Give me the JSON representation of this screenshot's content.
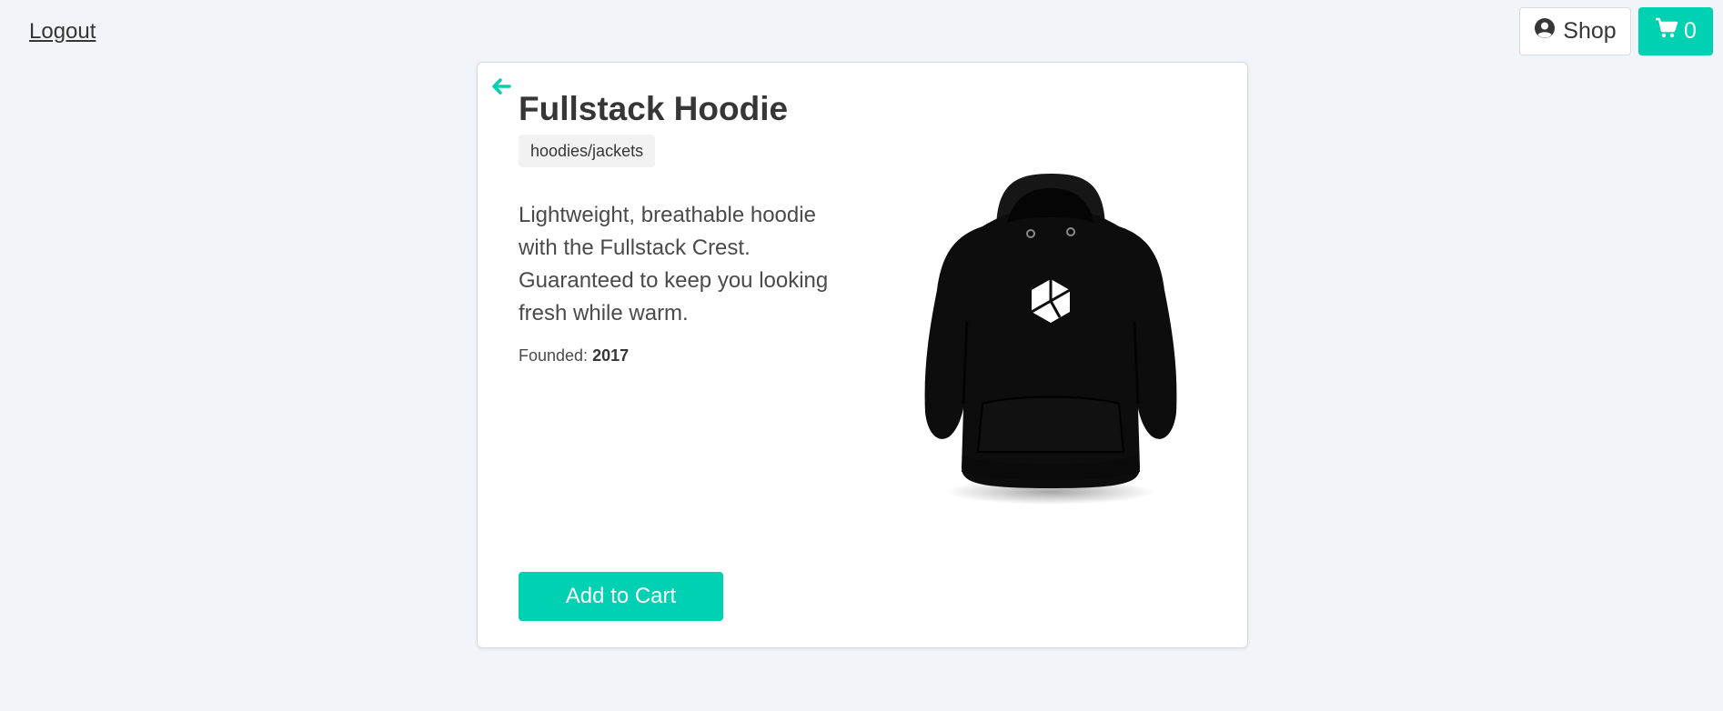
{
  "header": {
    "logout_label": "Logout",
    "shop_label": "Shop",
    "shop_icon": "user-circle-icon",
    "cart_count": "0",
    "cart_icon": "shopping-cart-icon"
  },
  "product": {
    "back_icon": "arrow-left-icon",
    "name": "Fullstack Hoodie",
    "category": "hoodies/jackets",
    "description": "Lightweight, breathable hoodie with the Fullstack Crest. Guaranteed to keep you looking fresh while warm.",
    "founded_label": "Founded: ",
    "founded_year": "2017",
    "add_to_cart_label": "Add to Cart"
  },
  "colors": {
    "accent": "#00d1b2",
    "background": "#f1f4f9",
    "text": "#363636"
  }
}
